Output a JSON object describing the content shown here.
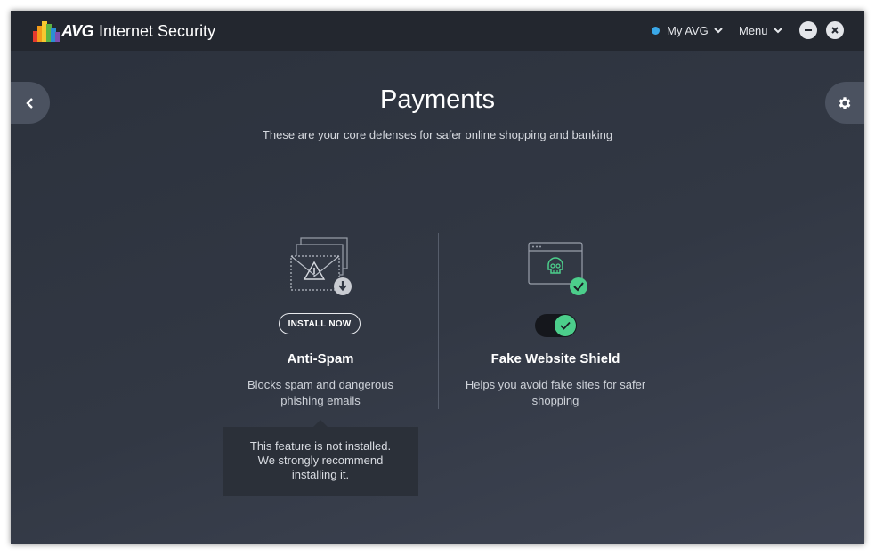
{
  "app": {
    "brand": "AVG",
    "product": "Internet Security",
    "my_avg_label": "My AVG",
    "menu_label": "Menu"
  },
  "page": {
    "title": "Payments",
    "subtitle": "These are your core defenses for safer online shopping and banking"
  },
  "features": [
    {
      "name": "Anti-Spam",
      "description": "Blocks spam and dangerous phishing emails",
      "action_label": "INSTALL NOW",
      "icon": "envelope-warning-icon",
      "status": "not installed"
    },
    {
      "name": "Fake Website Shield",
      "description": "Helps you avoid fake sites for safer shopping",
      "icon": "browser-skull-icon",
      "status": "on"
    }
  ],
  "tooltip": {
    "line1": "This feature is not installed.",
    "line2": "We strongly recommend",
    "line3": "installing it."
  },
  "colors": {
    "accent_green": "#4cce8b",
    "status_dot_blue": "#3aa8e8",
    "titlebar": "#23272f",
    "background": "#2f3541"
  }
}
